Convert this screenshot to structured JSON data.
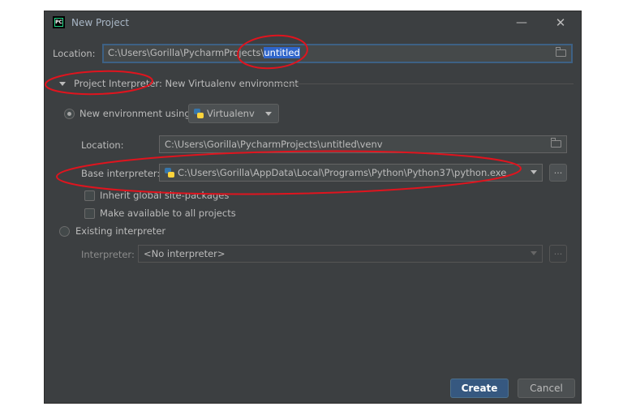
{
  "window": {
    "title": "New Project",
    "app_icon": "PC",
    "minimize_icon": "—",
    "close_icon": "✕"
  },
  "location": {
    "label": "Location:",
    "path_prefix": "C:\\Users\\Gorilla\\PycharmProjects\\",
    "path_selected": "untitled"
  },
  "interpreter_section": {
    "title": "Project Interpreter: New Virtualenv environment",
    "new_env": {
      "label": "New environment using",
      "tool": "Virtualenv",
      "location_label": "Location:",
      "location_value": "C:\\Users\\Gorilla\\PycharmProjects\\untitled\\venv",
      "base_label": "Base interpreter:",
      "base_value": "C:\\Users\\Gorilla\\AppData\\Local\\Programs\\Python\\Python37\\python.exe",
      "inherit_label": "Inherit global site-packages",
      "available_label": "Make available to all projects"
    },
    "existing": {
      "label": "Existing interpreter",
      "interpreter_label": "Interpreter:",
      "interpreter_value": "<No interpreter>"
    }
  },
  "browse_label": "...",
  "buttons": {
    "create": "Create",
    "cancel": "Cancel"
  },
  "colors": {
    "dialog_bg": "#3c3f41",
    "accent_button": "#365880",
    "selection": "#2f65ca",
    "annotation": "#e0141e"
  }
}
